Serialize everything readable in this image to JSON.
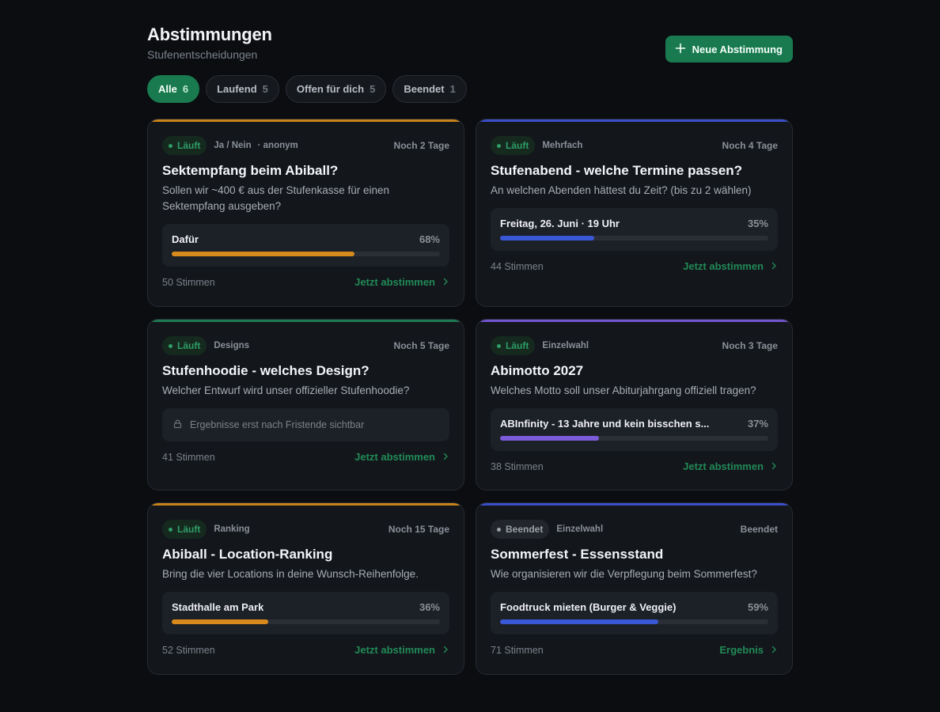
{
  "header": {
    "title": "Abstimmungen",
    "subtitle": "Stufenentscheidungen",
    "new_button": "Neue Abstimmung"
  },
  "filters": [
    {
      "label": "Alle",
      "count": "6",
      "active": true
    },
    {
      "label": "Laufend",
      "count": "5",
      "active": false
    },
    {
      "label": "Offen für dich",
      "count": "5",
      "active": false
    },
    {
      "label": "Beendet",
      "count": "1",
      "active": false
    }
  ],
  "colors": {
    "accent_green": "#1a7a4f",
    "orange": "#d88a1c",
    "blue": "#3a57d6",
    "purple": "#7c5bd9",
    "green": "#1f7a52"
  },
  "polls": [
    {
      "status": "Läuft",
      "status_kind": "running",
      "type": "Ja / Nein",
      "anon": "· anonym",
      "remaining": "Noch 2 Tage",
      "question": "Sektempfang beim Abiball?",
      "description": "Sollen wir ~400 € aus der Stufenkasse für einen Sektempfang ausgeben?",
      "result": {
        "option": "Dafür",
        "percent_label": "68%",
        "percent": 68,
        "color": "#d88a1c"
      },
      "accent": "#c9831b",
      "votes": "50 Stimmen",
      "cta": "Jetzt abstimmen"
    },
    {
      "status": "Läuft",
      "status_kind": "running",
      "type": "Mehrfach",
      "anon": "",
      "remaining": "Noch 4 Tage",
      "question": "Stufenabend - welche Termine passen?",
      "description": "An welchen Abenden hättest du Zeit? (bis zu 2 wählen)",
      "result": {
        "option": "Freitag, 26. Juni · 19 Uhr",
        "percent_label": "35%",
        "percent": 35,
        "color": "#3a57d6"
      },
      "accent": "#3a4fc9",
      "votes": "44 Stimmen",
      "cta": "Jetzt abstimmen"
    },
    {
      "status": "Läuft",
      "status_kind": "running",
      "type": "Designs",
      "anon": "",
      "remaining": "Noch 5 Tage",
      "question": "Stufenhoodie - welches Design?",
      "description": "Welcher Entwurf wird unser offizieller Stufenhoodie?",
      "hidden_note": "Ergebnisse erst nach Fristende sichtbar",
      "accent": "#1f7a52",
      "votes": "41 Stimmen",
      "cta": "Jetzt abstimmen"
    },
    {
      "status": "Läuft",
      "status_kind": "running",
      "type": "Einzelwahl",
      "anon": "",
      "remaining": "Noch 3 Tage",
      "question": "Abimotto 2027",
      "description": "Welches Motto soll unser Abiturjahrgang offiziell tragen?",
      "result": {
        "option": "ABInfinity - 13 Jahre und kein bisschen s...",
        "percent_label": "37%",
        "percent": 37,
        "color": "#7c5bd9"
      },
      "accent": "#7454cf",
      "votes": "38 Stimmen",
      "cta": "Jetzt abstimmen"
    },
    {
      "status": "Läuft",
      "status_kind": "running",
      "type": "Ranking",
      "anon": "",
      "remaining": "Noch 15 Tage",
      "question": "Abiball - Location-Ranking",
      "description": "Bring die vier Locations in deine Wunsch-Reihenfolge.",
      "result": {
        "option": "Stadthalle am Park",
        "percent_label": "36%",
        "percent": 36,
        "color": "#d88a1c"
      },
      "accent": "#c9831b",
      "votes": "52 Stimmen",
      "cta": "Jetzt abstimmen"
    },
    {
      "status": "Beendet",
      "status_kind": "ended",
      "type": "Einzelwahl",
      "anon": "",
      "remaining": "Beendet",
      "question": "Sommerfest - Essensstand",
      "description": "Wie organisieren wir die Verpflegung beim Sommerfest?",
      "result": {
        "option": "Foodtruck mieten (Burger & Veggie)",
        "percent_label": "59%",
        "percent": 59,
        "color": "#3a57d6"
      },
      "accent": "#3a4fc9",
      "votes": "71 Stimmen",
      "cta": "Ergebnis"
    }
  ]
}
